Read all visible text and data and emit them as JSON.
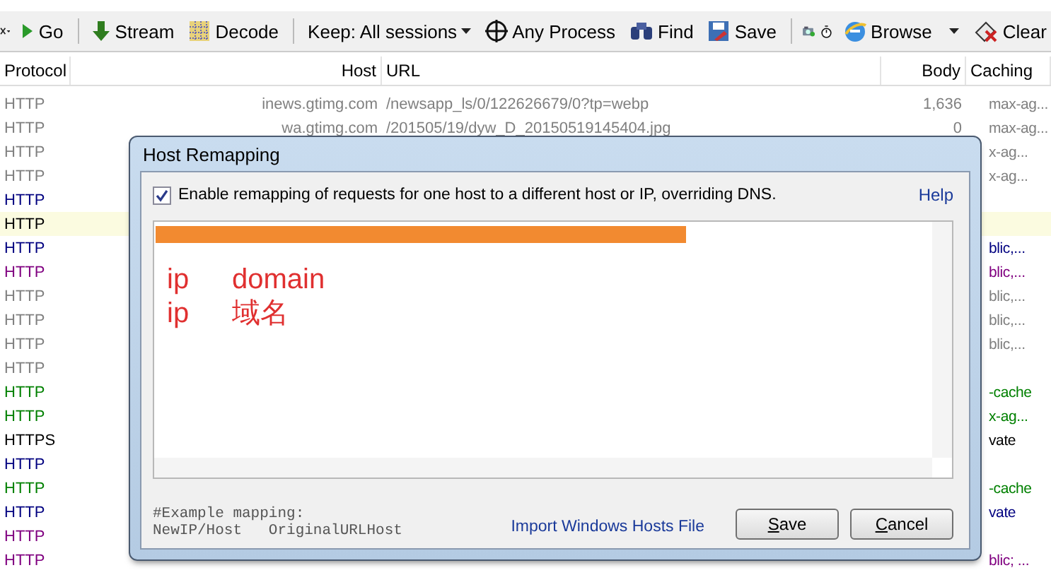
{
  "toolbar": {
    "items": [
      {
        "kind": "close"
      },
      {
        "kind": "go",
        "label": "Go"
      },
      {
        "kind": "stream",
        "label": "Stream"
      },
      {
        "kind": "decode",
        "label": "Decode"
      },
      {
        "kind": "dropdown",
        "label": "Keep: All sessions"
      },
      {
        "kind": "process",
        "label": "Any Process"
      },
      {
        "kind": "find",
        "label": "Find"
      },
      {
        "kind": "save",
        "label": "Save"
      },
      {
        "kind": "camera"
      },
      {
        "kind": "timer"
      },
      {
        "kind": "browse",
        "label": "Browse"
      },
      {
        "kind": "clear",
        "label": "Clear"
      }
    ]
  },
  "table": {
    "columns": [
      "Protocol",
      "Host",
      "URL",
      "Body",
      "Caching"
    ],
    "rows": [
      {
        "protocol": "HTTP",
        "host": "inews.gtimg.com",
        "url": "/newsapp_ls/0/122626679/0?tp=webp",
        "body": "1,636",
        "caching": "max-ag...",
        "color": "#808080",
        "highlighted": false
      },
      {
        "protocol": "HTTP",
        "host": "wa.gtimg.com",
        "url": "/201505/19/dyw_D_20150519145404.jpg",
        "body": "0",
        "caching": "max-ag...",
        "color": "#808080",
        "highlighted": false
      },
      {
        "protocol": "HTTP",
        "caching": "x-ag...",
        "color": "#808080",
        "highlighted": false
      },
      {
        "protocol": "HTTP",
        "caching": "x-ag...",
        "color": "#808080",
        "highlighted": false
      },
      {
        "protocol": "HTTP",
        "color": "#000080",
        "highlighted": false
      },
      {
        "protocol": "HTTP",
        "color": "#000000",
        "highlighted": true
      },
      {
        "protocol": "HTTP",
        "caching": "blic,...",
        "color": "#000080",
        "highlighted": false
      },
      {
        "protocol": "HTTP",
        "caching": "blic,...",
        "color": "#800080",
        "highlighted": false
      },
      {
        "protocol": "HTTP",
        "caching": "blic,...",
        "color": "#808080",
        "highlighted": false
      },
      {
        "protocol": "HTTP",
        "caching": "blic,...",
        "color": "#808080",
        "highlighted": false
      },
      {
        "protocol": "HTTP",
        "caching": "blic,...",
        "color": "#808080",
        "highlighted": false
      },
      {
        "protocol": "HTTP",
        "color": "#808080",
        "highlighted": false
      },
      {
        "protocol": "HTTP",
        "caching": "-cache",
        "color": "#008000",
        "highlighted": false
      },
      {
        "protocol": "HTTP",
        "caching": "x-ag...",
        "color": "#008000",
        "highlighted": false
      },
      {
        "protocol": "HTTPS",
        "caching": "vate",
        "color": "#000000",
        "highlighted": false
      },
      {
        "protocol": "HTTP",
        "color": "#000080",
        "highlighted": false
      },
      {
        "protocol": "HTTP",
        "caching": "-cache",
        "color": "#008000",
        "highlighted": false
      },
      {
        "protocol": "HTTP",
        "caching": "vate",
        "color": "#000080",
        "highlighted": false
      },
      {
        "protocol": "HTTP",
        "color": "#800080",
        "highlighted": false
      },
      {
        "protocol": "HTTP",
        "caching": "blic; ...",
        "color": "#800080",
        "highlighted": false
      }
    ]
  },
  "dialog": {
    "title": "Host Remapping",
    "enable": {
      "label": "Enable remapping of requests for one host to a different host or IP, overriding DNS.",
      "checked": true
    },
    "help": "Help",
    "editor": {
      "lines": [
        {
          "address": "ip",
          "host": "domain"
        },
        {
          "address": "ip",
          "host": "域名"
        }
      ]
    },
    "example": [
      "#Example mapping:",
      "NewIP/Host   OriginalURLHost"
    ],
    "import_link": "Import Windows Hosts File",
    "buttons": [
      "Save",
      "Cancel"
    ]
  }
}
